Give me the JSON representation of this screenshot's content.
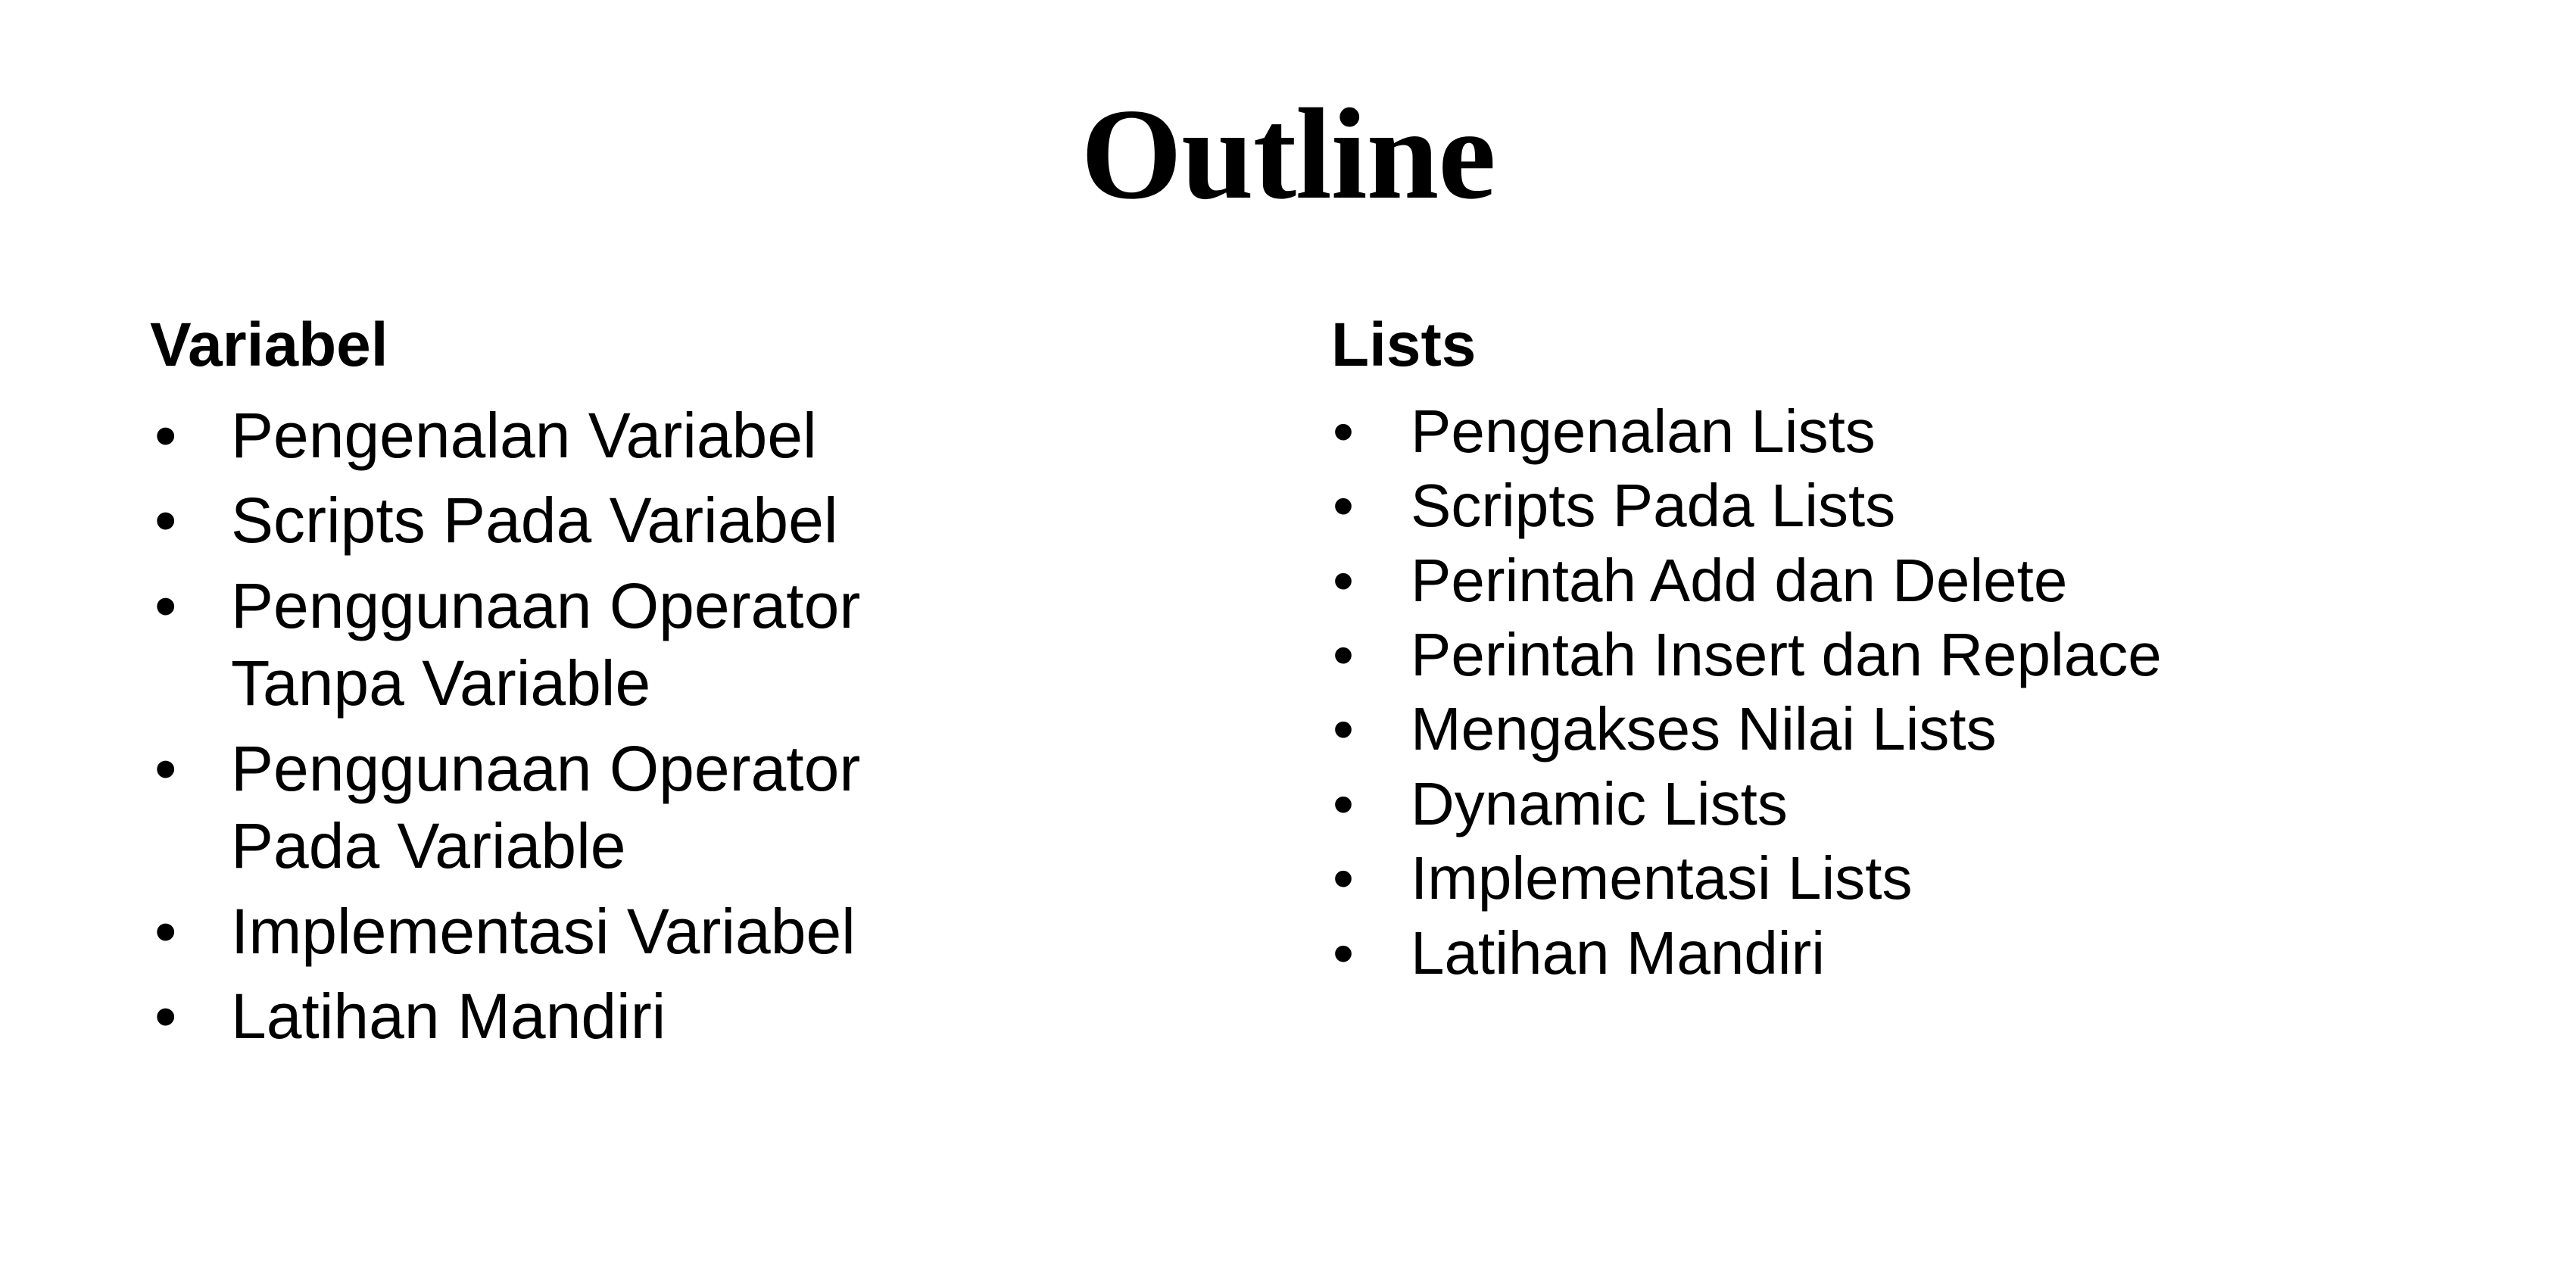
{
  "slide": {
    "title": "Outline",
    "background_color": "#ffffff",
    "text_color": "#000000",
    "bullet_glyph": "•"
  },
  "columns": {
    "left": {
      "heading": "Variabel",
      "items": [
        "Pengenalan Variabel",
        "Scripts Pada Variabel",
        "Penggunaan Operator Tanpa Variable",
        "Penggunaan Operator Pada Variable",
        "Implementasi Variabel",
        "Latihan Mandiri"
      ]
    },
    "right": {
      "heading": "Lists",
      "items": [
        "Pengenalan Lists",
        "Scripts Pada Lists",
        "Perintah Add dan Delete",
        "Perintah Insert dan Replace",
        "Mengakses Nilai Lists",
        "Dynamic Lists",
        "Implementasi Lists",
        "Latihan Mandiri"
      ]
    }
  }
}
